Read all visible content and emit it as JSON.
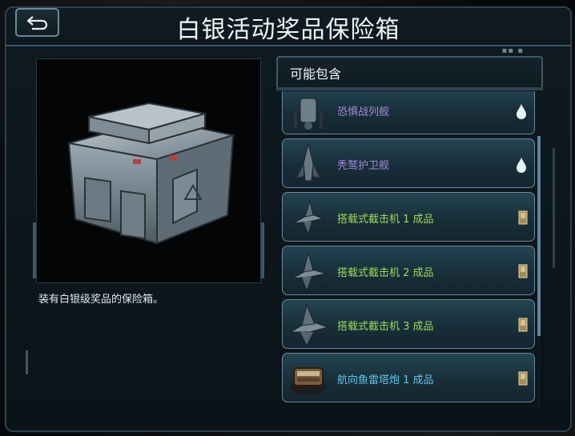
{
  "header": {
    "title": "白银活动奖品保险箱",
    "back_icon": "back-arrow-icon"
  },
  "left": {
    "description": "装有白银级奖品的保险箱。",
    "image": "silver-crate"
  },
  "contents": {
    "header": "可能包含",
    "items": [
      {
        "name": "恐惧战列舰",
        "kind": "ship",
        "tier_icon": "crystal-icon",
        "color": "#a58bd8"
      },
      {
        "name": "秃鹫护卫舰",
        "kind": "ship",
        "tier_icon": "crystal-icon",
        "color": "#a58bd8"
      },
      {
        "name": "搭载式截击机 1 成品",
        "kind": "plane",
        "tier_icon": "bronze-bar-icon",
        "color": "#9ed95a"
      },
      {
        "name": "搭载式截击机 2 成品",
        "kind": "plane",
        "tier_icon": "bronze-bar-icon",
        "color": "#9ed95a"
      },
      {
        "name": "搭载式截击机 3 成品",
        "kind": "plane",
        "tier_icon": "bronze-bar-icon",
        "color": "#9ed95a"
      },
      {
        "name": "航向鱼雷塔炮 1 成品",
        "kind": "turret",
        "tier_icon": "bronze-bar-icon",
        "color": "#5fc6ea"
      }
    ]
  },
  "colors": {
    "panel_border": "#6c8a99",
    "panel_fill": "#1c3845",
    "accent": "#3a5868"
  }
}
